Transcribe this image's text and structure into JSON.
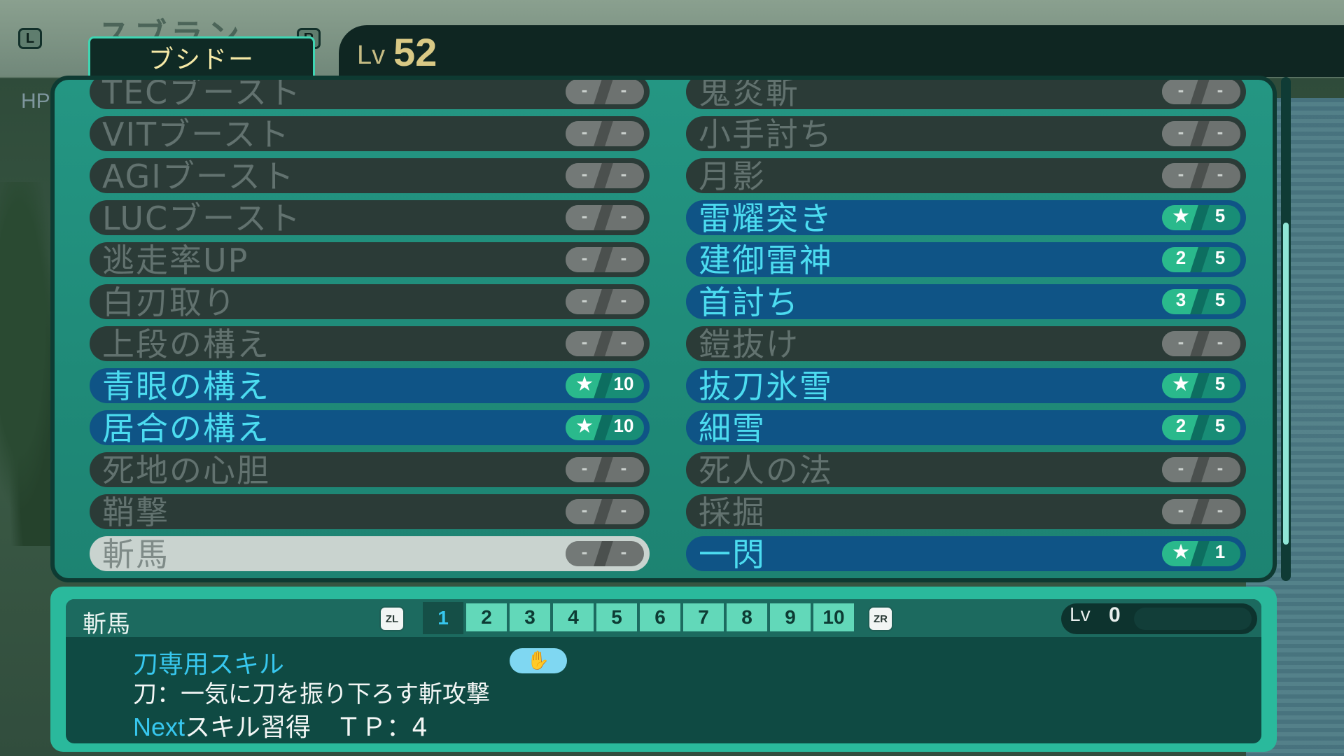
{
  "header": {
    "ghost_name": "スブラン",
    "l_button": "L",
    "r_button": "R",
    "class_name": "ブシドー",
    "level_label": "Lv",
    "level_value": "52",
    "hp_ghost": "HP"
  },
  "skills_left": [
    {
      "name": "TECブースト",
      "state": "off",
      "left": "-",
      "right": "-"
    },
    {
      "name": "VITブースト",
      "state": "off",
      "left": "-",
      "right": "-"
    },
    {
      "name": "AGIブースト",
      "state": "off",
      "left": "-",
      "right": "-"
    },
    {
      "name": "LUCブースト",
      "state": "off",
      "left": "-",
      "right": "-"
    },
    {
      "name": "逃走率UP",
      "state": "off",
      "left": "-",
      "right": "-"
    },
    {
      "name": "白刃取り",
      "state": "off",
      "left": "-",
      "right": "-"
    },
    {
      "name": "上段の構え",
      "state": "off",
      "left": "-",
      "right": "-"
    },
    {
      "name": "青眼の構え",
      "state": "on",
      "left": "★",
      "right": "10"
    },
    {
      "name": "居合の構え",
      "state": "on",
      "left": "★",
      "right": "10"
    },
    {
      "name": "死地の心胆",
      "state": "off",
      "left": "-",
      "right": "-"
    },
    {
      "name": "鞘撃",
      "state": "off",
      "left": "-",
      "right": "-"
    },
    {
      "name": "斬馬",
      "state": "selected",
      "left": "-",
      "right": "-"
    }
  ],
  "skills_right": [
    {
      "name": "鬼炎斬",
      "state": "off",
      "left": "-",
      "right": "-"
    },
    {
      "name": "小手討ち",
      "state": "off",
      "left": "-",
      "right": "-"
    },
    {
      "name": "月影",
      "state": "off",
      "left": "-",
      "right": "-"
    },
    {
      "name": "雷耀突き",
      "state": "on",
      "left": "★",
      "right": "5"
    },
    {
      "name": "建御雷神",
      "state": "on",
      "left": "2",
      "right": "5"
    },
    {
      "name": "首討ち",
      "state": "on",
      "left": "3",
      "right": "5"
    },
    {
      "name": "鎧抜け",
      "state": "off",
      "left": "-",
      "right": "-"
    },
    {
      "name": "抜刀氷雪",
      "state": "on",
      "left": "★",
      "right": "5"
    },
    {
      "name": "細雪",
      "state": "on",
      "left": "2",
      "right": "5"
    },
    {
      "name": "死人の法",
      "state": "off",
      "left": "-",
      "right": "-"
    },
    {
      "name": "採掘",
      "state": "off",
      "left": "-",
      "right": "-"
    },
    {
      "name": "一閃",
      "state": "on",
      "left": "★",
      "right": "1"
    }
  ],
  "detail": {
    "skill_name": "斬馬",
    "zl_label": "ZL",
    "zr_label": "ZR",
    "level_tabs": [
      "1",
      "2",
      "3",
      "4",
      "5",
      "6",
      "7",
      "8",
      "9",
      "10"
    ],
    "active_level_tab": 0,
    "lv_label": "Lv",
    "lv_value": "0",
    "weapon_skill": "刀専用スキル",
    "hand_icon": "✋",
    "description": "刀：一気に刀を振り下ろす斬攻撃",
    "next_word": "Next",
    "next_rest": "スキル習得　ＴＰ：4"
  },
  "colors": {
    "panel": "#249683",
    "active_row": "#0f5486",
    "inactive_row": "#2b3b37",
    "cyan_text": "#37c7ee",
    "gold_text": "#d9c985"
  }
}
